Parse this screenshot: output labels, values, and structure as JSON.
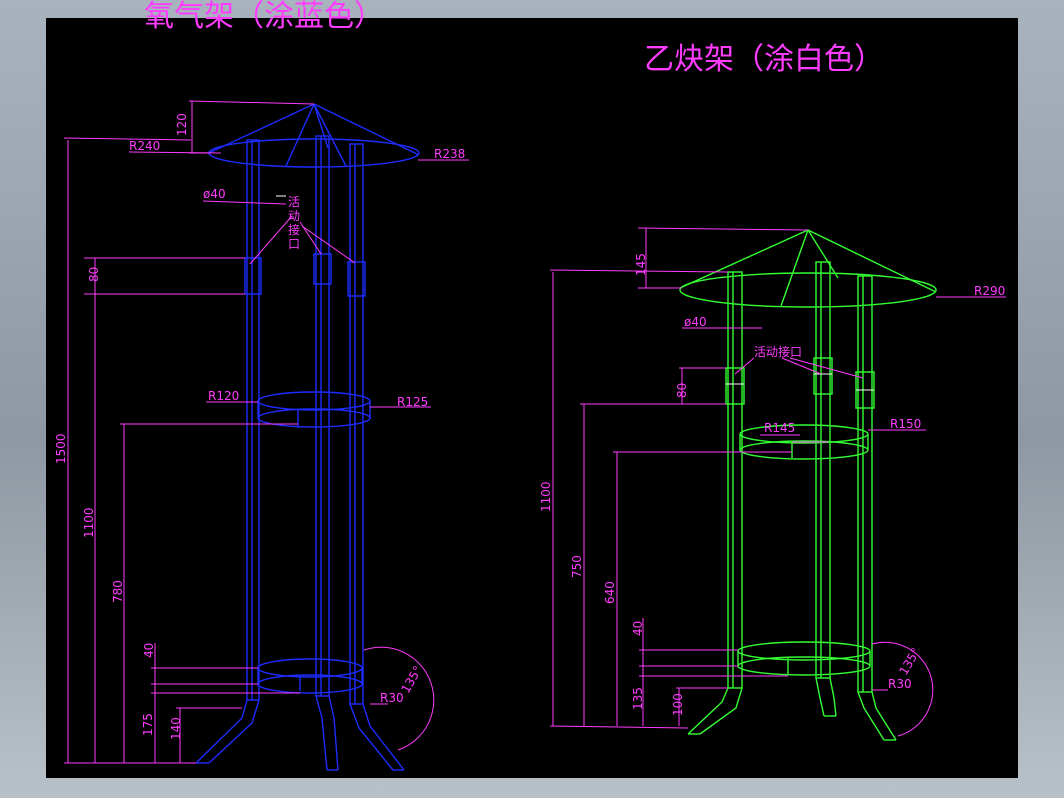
{
  "titles": {
    "oxygen_rack": "氧气架（涂蓝色）",
    "acetylene_rack": "乙炔架（涂白色）"
  },
  "oxygen_dims": {
    "roof_height": "120",
    "roof_radius_left": "R240",
    "roof_radius_right": "R238",
    "pipe_dia": "ø40",
    "joint_note": [
      "活",
      "动",
      "接",
      "口"
    ],
    "joint_height": "80",
    "total_height": "1500",
    "upper_ring_height": "1100",
    "ring_radius_left": "R120",
    "ring_radius_right": "R125",
    "ring_height": "780",
    "bottom_ring_width": "40",
    "foot_height": "175",
    "leg_height": "140",
    "bend_radius": "R30",
    "bend_angle": "135°"
  },
  "acetylene_dims": {
    "roof_height": "145",
    "roof_radius": "R290",
    "pipe_dia": "ø40",
    "joint_note": "活动接口",
    "joint_height": "80",
    "upper_ring_radius": "R145",
    "ring_radius_right": "R150",
    "total_height": "1100",
    "mid_height": "750",
    "ring_height": "640",
    "bottom_ring_width": "40",
    "foot_height": "135",
    "leg_height": "100",
    "bend_radius": "R30",
    "bend_angle": "135°"
  }
}
